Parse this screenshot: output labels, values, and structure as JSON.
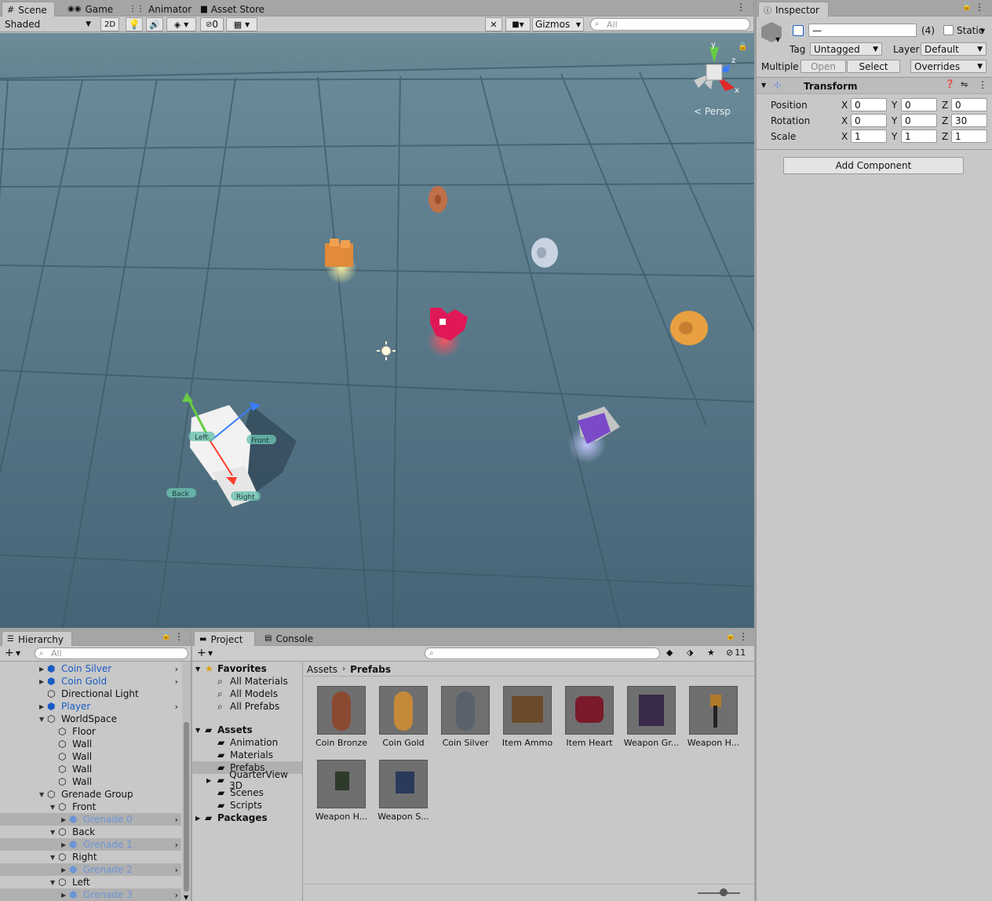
{
  "scene": {
    "tabs": [
      {
        "label": "Scene",
        "icon": "hash-icon"
      },
      {
        "label": "Game",
        "icon": "gamepad-icon"
      },
      {
        "label": "Animator",
        "icon": "animator-icon"
      },
      {
        "label": "Asset Store",
        "icon": "store-icon"
      }
    ],
    "shading_mode": "Shaded",
    "mode_2d": "2D",
    "hidden_count": "0",
    "gizmos_label": "Gizmos",
    "search_placeholder": "All",
    "view_label": "Persp",
    "axis_labels": {
      "x": "x",
      "y": "y",
      "z": "z"
    },
    "player_labels": {
      "left": "Left",
      "front": "Front",
      "back": "Back",
      "right": "Right"
    }
  },
  "inspector": {
    "tab_label": "Inspector",
    "object_name": "—",
    "multi_count": "(4)",
    "static_label": "Static",
    "tag_label": "Tag",
    "tag_value": "Untagged",
    "layer_label": "Layer",
    "layer_value": "Default",
    "multiple_label": "Multiple",
    "open_label": "Open",
    "select_label": "Select",
    "overrides_label": "Overrides",
    "transform_title": "Transform",
    "rows": [
      {
        "label": "Position",
        "x": "0",
        "y": "0",
        "z": "0"
      },
      {
        "label": "Rotation",
        "x": "0",
        "y": "0",
        "z": "30"
      },
      {
        "label": "Scale",
        "x": "1",
        "y": "1",
        "z": "1"
      }
    ],
    "axis": {
      "x": "X",
      "y": "Y",
      "z": "Z"
    },
    "add_component": "Add Component"
  },
  "hierarchy": {
    "tab_label": "Hierarchy",
    "search_placeholder": "All",
    "items": [
      {
        "label": "Coin Silver",
        "style": "blue",
        "arrow": true
      },
      {
        "label": "Coin Gold",
        "style": "blue",
        "arrow": true
      },
      {
        "label": "Directional Light",
        "style": "normal",
        "arrow": false
      },
      {
        "label": "Player",
        "style": "blue",
        "arrow": true
      },
      {
        "label": "WorldSpace",
        "style": "normal",
        "arrow": false
      },
      {
        "label": "Floor",
        "style": "normal",
        "arrow": false
      },
      {
        "label": "Wall",
        "style": "normal",
        "arrow": false
      },
      {
        "label": "Wall",
        "style": "normal",
        "arrow": false
      },
      {
        "label": "Wall",
        "style": "normal",
        "arrow": false
      },
      {
        "label": "Wall",
        "style": "normal",
        "arrow": false
      },
      {
        "label": "Grenade Group",
        "style": "normal",
        "arrow": false
      },
      {
        "label": "Front",
        "style": "normal",
        "arrow": false
      },
      {
        "label": "Grenade 0",
        "style": "faint",
        "arrow": true
      },
      {
        "label": "Back",
        "style": "normal",
        "arrow": false
      },
      {
        "label": "Grenade 1",
        "style": "faint",
        "arrow": true
      },
      {
        "label": "Right",
        "style": "normal",
        "arrow": false
      },
      {
        "label": "Grenade 2",
        "style": "faint",
        "arrow": true
      },
      {
        "label": "Left",
        "style": "normal",
        "arrow": false
      },
      {
        "label": "Grenade 3",
        "style": "faint",
        "arrow": true
      }
    ]
  },
  "project": {
    "tabs": [
      {
        "label": "Project"
      },
      {
        "label": "Console"
      }
    ],
    "hidden_count": "11",
    "breadcrumb": {
      "root": "Assets",
      "current": "Prefabs"
    },
    "tree": [
      {
        "label": "Favorites",
        "bold": true
      },
      {
        "label": "All Models"
      },
      {
        "label": "All Prefabs"
      },
      {
        "label": "All Materials"
      },
      {
        "label": "Assets",
        "bold": true
      },
      {
        "label": "Animation"
      },
      {
        "label": "Materials"
      },
      {
        "label": "Prefabs"
      },
      {
        "label": "QuarterView 3D"
      },
      {
        "label": "Scenes"
      },
      {
        "label": "Scripts"
      },
      {
        "label": "Packages",
        "bold": true
      }
    ],
    "assets": [
      {
        "label": "Coin Bronze",
        "color": "#8a4a32"
      },
      {
        "label": "Coin Gold",
        "color": "#c48a3a"
      },
      {
        "label": "Coin Silver",
        "color": "#59626c"
      },
      {
        "label": "Item Ammo",
        "color": "#6a4a2a"
      },
      {
        "label": "Item Heart",
        "color": "#7a1a2a"
      },
      {
        "label": "Weapon Gr...",
        "color": "#3a2a4a"
      },
      {
        "label": "Weapon H...",
        "color": "#b07a2a"
      },
      {
        "label": "Weapon H...",
        "color": "#2e3a2a"
      },
      {
        "label": "Weapon S...",
        "color": "#2a3a5a"
      }
    ]
  }
}
